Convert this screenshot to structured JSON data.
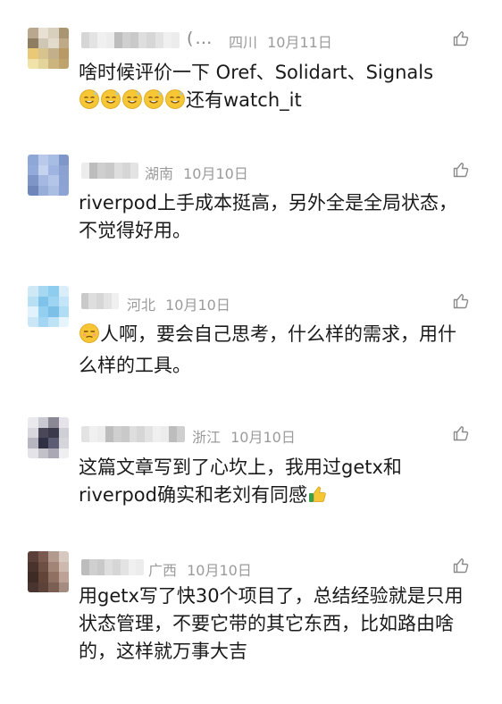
{
  "comments": [
    {
      "name_suffix": "(…",
      "region": "四川",
      "date": "10月11日",
      "text": "啥时候评价一下 Oref、Solidart、Signals",
      "text2": "还有watch_it",
      "avatar_colors": [
        "#b9a88f",
        "#e7e0d3",
        "#d8cfbd",
        "#a99572",
        "#8f7d62",
        "#cfc6b5",
        "#e2dbcc",
        "#bfa987",
        "#e9c978",
        "#d6c38e",
        "#c3b08a",
        "#b79a64",
        "#f0e2a8",
        "#e3d49b",
        "#cbb47d",
        "#bfa36d"
      ]
    },
    {
      "name_suffix": "",
      "region": "湖南",
      "date": "10月10日",
      "text": "riverpod上手成本挺高，另外全是全局状态，不觉得好用。",
      "avatar_colors": [
        "#8ea7d6",
        "#b9c9ea",
        "#a8bde4",
        "#7f97c8",
        "#93abdb",
        "#c6d3ee",
        "#9fb4e0",
        "#8aa1d2",
        "#7e95c7",
        "#a5b8e2",
        "#b3c5e9",
        "#8ba2d3",
        "#6f86bb",
        "#98aed9",
        "#aabde3",
        "#8ca3d4"
      ]
    },
    {
      "name_suffix": "",
      "region": "河北",
      "date": "10月10日",
      "text": "人啊，要会自己思考，什么样的需求，用什么样的工具。",
      "avatar_colors": [
        "#cfe8f6",
        "#a7d8f2",
        "#8fcdef",
        "#d9eef9",
        "#b8e0f5",
        "#7fc3ea",
        "#9dd4f1",
        "#c3e5f7",
        "#e0f2fb",
        "#93cff0",
        "#7cc0e8",
        "#b0dcf4",
        "#cbe7f7",
        "#a3d6f2",
        "#bfe3f6",
        "#e6f4fb"
      ]
    },
    {
      "name_suffix": "",
      "region": "浙江",
      "date": "10月10日",
      "text": "这篇文章写到了心坎上，我用过getx和riverpod确实和老刘有同感",
      "avatar_colors": [
        "#e9e9ee",
        "#c9c9d2",
        "#8a8895",
        "#e6e4ea",
        "#d8d7de",
        "#4a4858",
        "#3a3a4c",
        "#cfcfd7",
        "#b7b6c0",
        "#2f3044",
        "#5b5c74",
        "#d6d5dc",
        "#e4e3e8",
        "#c2c1ca",
        "#a9a8b4",
        "#efeff2"
      ]
    },
    {
      "name_suffix": "",
      "region": "广西",
      "date": "10月10日",
      "text": "用getx写了快30个项目了，总结经验就是只用状态管理，不要它带的其它东西，比如路由啥的，这样就万事大吉",
      "avatar_colors": [
        "#5a4038",
        "#7a5a4e",
        "#b39a8e",
        "#d8c9c0",
        "#4b332d",
        "#6e4f44",
        "#a28577",
        "#cdb9ad",
        "#3f2b26",
        "#634439",
        "#8f7062",
        "#bca395",
        "#4a3430",
        "#5d4239",
        "#7c5f53",
        "#a58c80"
      ]
    }
  ],
  "icons": {
    "like": "thumbs-up-icon",
    "emoji_sweat": "sweat-smile-emoji",
    "emoji_pensive": "unamused-face-emoji",
    "emoji_thumbs": "thumbs-up-emoji"
  }
}
